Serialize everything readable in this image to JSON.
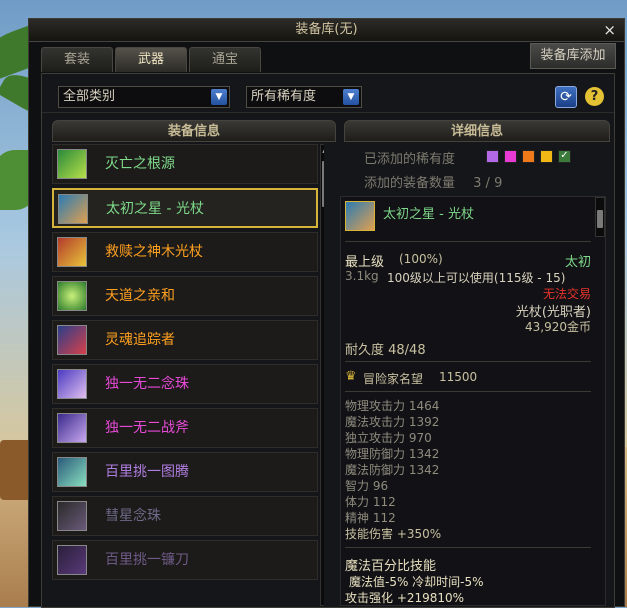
{
  "window": {
    "title": "装备库(无)",
    "close_label": "×"
  },
  "tabs": [
    {
      "label": "套装",
      "active": false
    },
    {
      "label": "武器",
      "active": true
    },
    {
      "label": "通宝",
      "active": false
    }
  ],
  "add_button": "装备库添加",
  "filters": {
    "category": "全部类别",
    "rarity": "所有稀有度",
    "refresh_icon": "refresh-icon",
    "help_label": "?"
  },
  "list_header": "装备信息",
  "detail_header": "详细信息",
  "items": [
    {
      "name": "灭亡之根源",
      "color": "#7fd98a",
      "icon": "ring-icon",
      "selected": false
    },
    {
      "name": "太初之星 - 光杖",
      "color": "#7fd98a",
      "icon": "staff-icon",
      "selected": true
    },
    {
      "name": "救赎之神木光杖",
      "color": "#ffa020",
      "icon": "staff-icon",
      "selected": false
    },
    {
      "name": "天道之亲和",
      "color": "#ffa020",
      "icon": "orb-icon",
      "selected": false
    },
    {
      "name": "灵魂追踪者",
      "color": "#ffa020",
      "icon": "scythe-icon",
      "selected": false
    },
    {
      "name": "独一无二念珠",
      "color": "#e84ad8",
      "icon": "beads-icon",
      "selected": false
    },
    {
      "name": "独一无二战斧",
      "color": "#e84ad8",
      "icon": "axe-icon",
      "selected": false
    },
    {
      "name": "百里挑一图腾",
      "color": "#b07ee0",
      "icon": "totem-icon",
      "selected": false
    },
    {
      "name": "彗星念珠",
      "color": "#6e6a8a",
      "icon": "beads-icon",
      "selected": false
    },
    {
      "name": "百里挑一镰刀",
      "color": "#6e5a86",
      "icon": "scythe-icon",
      "selected": false
    }
  ],
  "detail": {
    "rarity_label": "已添加的稀有度",
    "rarity_colors": [
      "#b368e8",
      "#e83bd6",
      "#f07a1a",
      "#f2b714"
    ],
    "rarity_check": "✓",
    "count_label": "添加的装备数量",
    "count_value": "3 / 9",
    "item_name": "太初之星 - 光杖",
    "grade": "最上级",
    "grade_pct": "(100%)",
    "rarity_name": "太初",
    "weight": "3.1kg",
    "level_req": "100级以上可以使用(115级 - 15)",
    "trade": "无法交易",
    "type": "光杖(光职者)",
    "price": "43,920金币",
    "durability": "耐久度 48/48",
    "fame_label": "冒险家名望",
    "fame_value": "11500",
    "stats": [
      {
        "name": "物理攻击力",
        "value": "1464"
      },
      {
        "name": "魔法攻击力",
        "value": "1392"
      },
      {
        "name": "独立攻击力",
        "value": "970"
      },
      {
        "name": "物理防御力",
        "value": "1342"
      },
      {
        "name": "魔法防御力",
        "value": "1342"
      },
      {
        "name": "智力",
        "value": "96"
      },
      {
        "name": "体力",
        "value": "112"
      },
      {
        "name": "精神",
        "value": "112"
      },
      {
        "name": "技能伤害",
        "value": "+350%"
      }
    ],
    "skill_title": "魔法百分比技能",
    "skill_line1": "魔法值-5% 冷却时间-5%",
    "skill_line2": "攻击强化 +219810%"
  },
  "colors": {
    "gold": "#d6b43a",
    "green": "#7fd98a",
    "orange": "#ffa020",
    "red": "#e8332a"
  }
}
